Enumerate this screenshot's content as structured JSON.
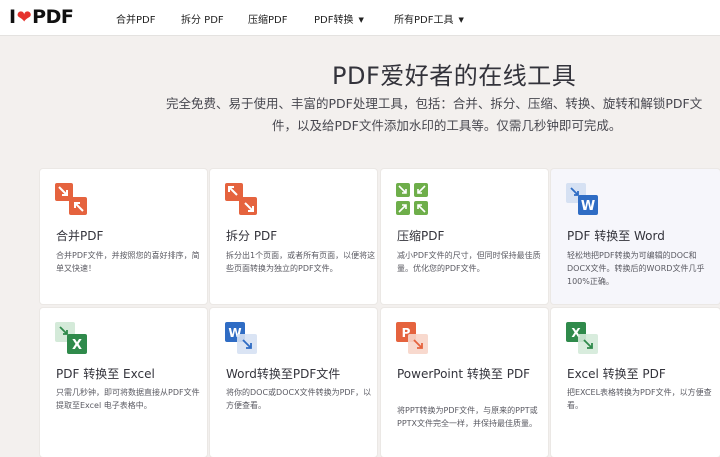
{
  "brand": {
    "logo_left": "I",
    "logo_right": "PDF"
  },
  "nav": {
    "merge": "合并PDF",
    "split": "拆分 PDF",
    "compress": "压缩PDF",
    "convert": "PDF转换",
    "all_tools": "所有PDF工具"
  },
  "hero": {
    "title": "PDF爱好者的在线工具",
    "line1": "完全免费、易于使用、丰富的PDF处理工具，包括：合并、拆分、压缩、转换、旋转和解锁PDF文",
    "line2": "件，以及给PDF文件添加水印的工具等。仅需几秒钟即可完成。"
  },
  "cards": [
    {
      "name": "合并PDF",
      "desc": "合并PDF文件，并按照您的喜好排序，简单又快速！",
      "icon": "merge-icon",
      "color": "#e5633e"
    },
    {
      "name": "拆分 PDF",
      "desc": "拆分出1个页面，或者所有页面，以便将这些页面转换为独立的PDF文件。",
      "icon": "split-icon",
      "color": "#e5633e"
    },
    {
      "name": "压缩PDF",
      "desc": "减小PDF文件的尺寸，但同时保持最佳质量。优化您的PDF文件。",
      "icon": "compress-icon",
      "color": "#6eae4a"
    },
    {
      "name": "PDF 转换至 Word",
      "desc": "轻松地把PDF转换为可编辑的DOC和DOCX文件。转换后的WORD文件几乎100%正确。",
      "icon": "pdf-to-word-icon",
      "color": "#2f6cc4"
    },
    {
      "name": "PDF 转换至 Excel",
      "desc": "只需几秒钟，即可将数据直接从PDF文件提取至Excel 电子表格中。",
      "icon": "pdf-to-excel-icon",
      "color": "#2f8a4b"
    },
    {
      "name": "Word转换至PDF文件",
      "desc": "将你的DOC或DOCX文件转换为PDF，以方便查看。",
      "icon": "word-to-pdf-icon",
      "color": "#2f6cc4"
    },
    {
      "name": "PowerPoint 转换至 PDF",
      "desc": "将PPT转换为PDF文件，与原来的PPT或PPTX文件完全一样，并保持最佳质量。",
      "icon": "ppt-to-pdf-icon",
      "color": "#e5633e"
    },
    {
      "name": "Excel 转换至 PDF",
      "desc": "把EXCEL表格转换为PDF文件，以方便查看。",
      "icon": "excel-to-pdf-icon",
      "color": "#2f8a4b"
    }
  ],
  "icon_letters": {
    "word": "W",
    "excel": "X",
    "ppt": "P"
  },
  "colors": {
    "accent": "#e5322d",
    "background": "#f3f0ee",
    "card": "#ffffff"
  }
}
